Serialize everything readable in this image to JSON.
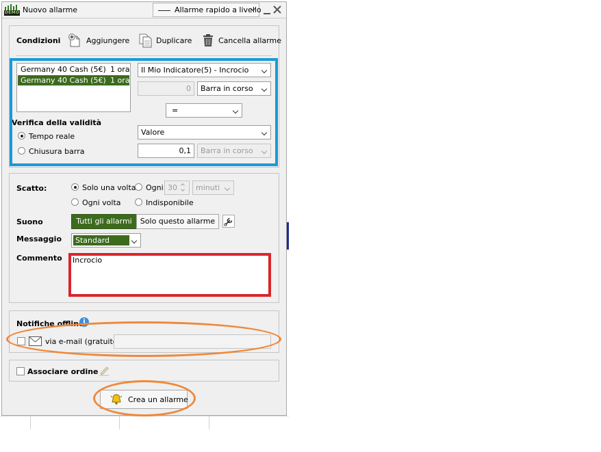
{
  "window": {
    "title": "Nuovo allarme",
    "quick_alarm_label": "Allarme rapido a livello",
    "demo_badge": "DEMO"
  },
  "toolbar": {
    "section_label": "Condizioni",
    "add_label": "Aggiungere",
    "duplicate_label": "Duplicare",
    "delete_label": "Cancella allarme"
  },
  "instruments": [
    {
      "name": "Germany 40 Cash (5€)",
      "timeframe": "1 ora",
      "selected": false
    },
    {
      "name": "Germany 40 Cash (5€)",
      "timeframe": "1 ora",
      "selected": true
    }
  ],
  "conditions": {
    "indicator": "Il Mio Indicatore(5)  - Incrocio",
    "offset_value": "0",
    "bar_mode": "Barra in corso",
    "operator": "=",
    "compare_type": "Valore",
    "compare_value": "0,1",
    "compare_bar_mode": "Barra in corso"
  },
  "validity": {
    "title": "Verifica della validità",
    "realtime_label": "Tempo reale",
    "bar_close_label": "Chiusura barra",
    "selected": "realtime"
  },
  "trigger": {
    "label": "Scatto:",
    "once_label": "Solo una volta",
    "every_label": "Ogni",
    "every_value": "30",
    "every_unit": "minuti",
    "each_time_label": "Ogni volta",
    "unavailable_label": "Indisponibile",
    "selected": "once"
  },
  "sound": {
    "label": "Suono",
    "all_alarms_label": "Tutti gli allarmi",
    "this_alarm_label": "Solo questo allarme"
  },
  "message": {
    "label": "Messaggio",
    "value": "Standard"
  },
  "comment": {
    "label": "Commento",
    "value": "Incrocio"
  },
  "offline": {
    "title": "Notifiche offline",
    "email_label": "via e-mail (gratuito)",
    "email_value": ""
  },
  "order": {
    "label": "Associare ordine"
  },
  "footer": {
    "create_label": "Crea un allarme"
  },
  "colors": {
    "accent_green": "#3d6b1e",
    "highlight_blue": "#1a9ad6",
    "highlight_red": "#d9252a",
    "highlight_orange": "#f0883a"
  }
}
